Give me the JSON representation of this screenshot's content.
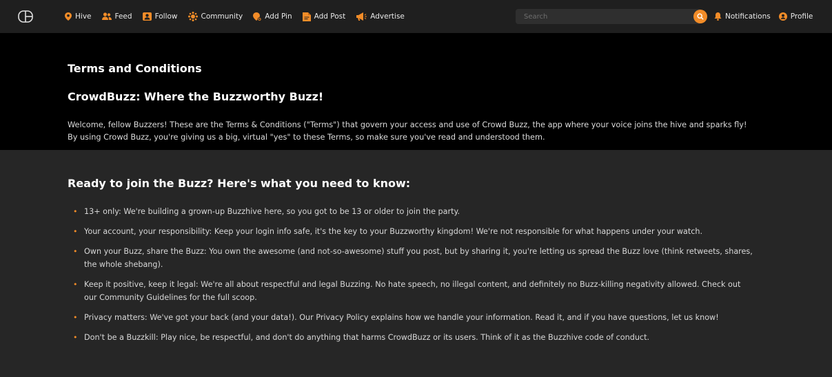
{
  "nav": {
    "items": [
      {
        "label": "Hive",
        "icon": "map-pin-icon"
      },
      {
        "label": "Feed",
        "icon": "users-icon"
      },
      {
        "label": "Follow",
        "icon": "follow-icon"
      },
      {
        "label": "Community",
        "icon": "community-icon"
      },
      {
        "label": "Add Pin",
        "icon": "add-pin-icon"
      },
      {
        "label": "Add Post",
        "icon": "add-post-icon"
      },
      {
        "label": "Advertise",
        "icon": "megaphone-icon"
      }
    ],
    "search_placeholder": "Search",
    "notifications_label": "Notifications",
    "profile_label": "Profile",
    "accent_color": "#f28c28"
  },
  "header": {
    "title": "Terms and Conditions",
    "subtitle": "CrowdBuzz: Where the Buzzworthy Buzz!",
    "intro": "Welcome, fellow Buzzers! These are the Terms & Conditions (\"Terms\") that govern your access and use of Crowd Buzz, the app where your voice joins the hive and sparks fly! By using Crowd Buzz, you're giving us a big, virtual \"yes\" to these Terms, so make sure you've read and understood them."
  },
  "main": {
    "heading": "Ready to join the Buzz? Here's what you need to know:",
    "rules": [
      "13+ only: We're building a grown-up Buzzhive here, so you got to be 13 or older to join the party.",
      "Your account, your responsibility: Keep your login info safe, it's the key to your Buzzworthy kingdom! We're not responsible for what happens under your watch.",
      "Own your Buzz, share the Buzz: You own the awesome (and not-so-awesome) stuff you post, but by sharing it, you're letting us spread the Buzz love (think retweets, shares, the whole shebang).",
      "Keep it positive, keep it legal: We're all about respectful and legal Buzzing. No hate speech, no illegal content, and definitely no Buzz-killing negativity allowed. Check out our Community Guidelines for the full scoop.",
      "Privacy matters: We've got your back (and your data!). Our Privacy Policy explains how we handle your information. Read it, and if you have questions, let us know!",
      "Don't be a Buzzkill: Play nice, be respectful, and don't do anything that harms CrowdBuzz or its users. Think of it as the Buzzhive code of conduct."
    ]
  }
}
